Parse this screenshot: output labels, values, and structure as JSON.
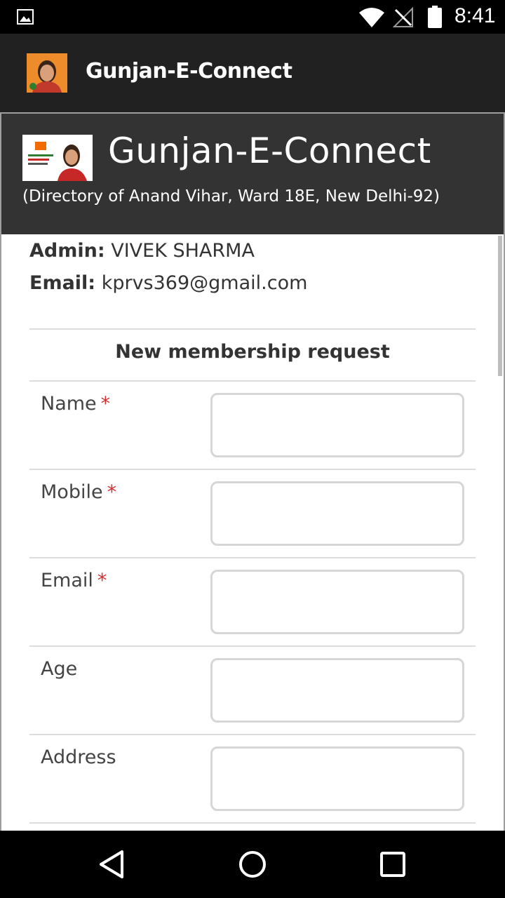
{
  "status_bar": {
    "time": "8:41",
    "icons": [
      "gallery-notification-icon",
      "wifi-icon",
      "no-signal-icon",
      "battery-icon"
    ]
  },
  "app_bar": {
    "title": "Gunjan-E-Connect",
    "logo": "profile-photo"
  },
  "header": {
    "title": "Gunjan-E-Connect",
    "subtitle": "(Directory of Anand Vihar, Ward 18E, New Delhi-92)"
  },
  "admin": {
    "label": "Admin:",
    "value": "VIVEK SHARMA"
  },
  "email": {
    "label": "Email:",
    "value": "kprvs369@gmail.com"
  },
  "form": {
    "heading": "New membership request",
    "required_mark": "*",
    "fields": [
      {
        "label": "Name",
        "required": true,
        "value": ""
      },
      {
        "label": "Mobile",
        "required": true,
        "value": ""
      },
      {
        "label": "Email",
        "required": true,
        "value": ""
      },
      {
        "label": "Age",
        "required": false,
        "value": ""
      },
      {
        "label": "Address",
        "required": false,
        "value": ""
      }
    ]
  },
  "nav_bar": {
    "buttons": [
      "back-icon",
      "home-icon",
      "recents-icon"
    ]
  },
  "colors": {
    "app_bar": "#212121",
    "header_panel": "#333333",
    "required": "#d32f2f"
  }
}
